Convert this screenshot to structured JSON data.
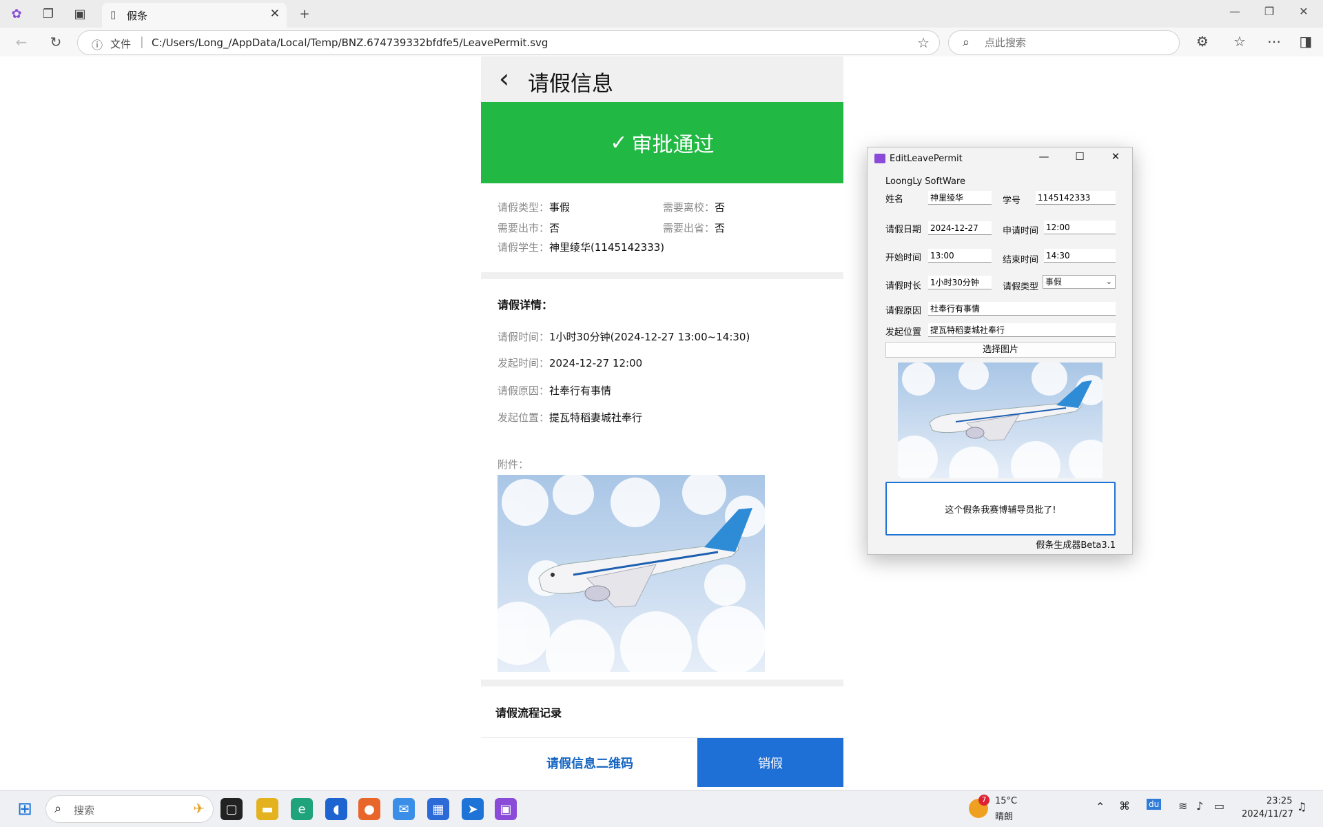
{
  "browser": {
    "tab_title": "假条",
    "address_file_label": "文件",
    "url": "C:/Users/Long_/AppData/Local/Temp/BNZ.674739332bfdfe5/LeavePermit.svg",
    "search_placeholder": "点此搜索"
  },
  "page": {
    "header_title": "请假信息",
    "status": "审批通过",
    "summary": {
      "leave_type_label": "请假类型：",
      "leave_type": "事假",
      "leave_school_label": "需要离校：",
      "leave_school": "否",
      "leave_city_label": "需要出市：",
      "leave_city": "否",
      "leave_province_label": "需要出省：",
      "leave_province": "否",
      "student_label": "请假学生：",
      "student": "神里绫华(1145142333)"
    },
    "details_title": "请假详情：",
    "details": {
      "time_label": "请假时间：",
      "time": "1小时30分钟(2024-12-27 13:00~14:30)",
      "submit_label": "发起时间：",
      "submit": "2024-12-27 12:00",
      "reason_label": "请假原因：",
      "reason": "社奉行有事情",
      "location_label": "发起位置：",
      "location": "提瓦特稻妻城社奉行"
    },
    "attachment_label": "附件：",
    "process_title": "请假流程记录",
    "qr_button": "请假信息二维码",
    "cancel_button": "销假"
  },
  "dialog": {
    "title": "EditLeavePermit",
    "company": "LoongLy SoftWare",
    "name_label": "姓名",
    "name": "神里绫华",
    "id_label": "学号",
    "id": "1145142333",
    "date_label": "请假日期",
    "date": "2024-12-27",
    "apply_time_label": "申请时间",
    "apply_time": "12:00",
    "start_label": "开始时间",
    "start": "13:00",
    "end_label": "结束时间",
    "end": "14:30",
    "duration_label": "请假时长",
    "duration": "1小时30分钟",
    "type_label": "请假类型",
    "type": "事假",
    "reason_label": "请假原因",
    "reason": "社奉行有事情",
    "location_label": "发起位置",
    "location": "提瓦特稻妻城社奉行",
    "pick_image": "选择图片",
    "message": "这个假条我赛博辅导员批了!",
    "footer": "假条生成器Beta3.1"
  },
  "taskbar": {
    "search": "搜索",
    "weather_badge": "7",
    "temp": "15°C",
    "weather": "晴朗",
    "time": "23:25",
    "date": "2024/11/27"
  },
  "colors": {
    "approved_green": "#22b844",
    "primary_blue": "#1e6fd6"
  }
}
